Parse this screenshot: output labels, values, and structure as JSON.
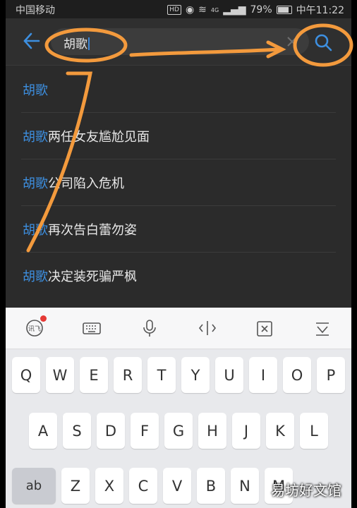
{
  "status": {
    "carrier": "中国移动",
    "battery": "79%",
    "time": "中午11:22",
    "hd": "HD",
    "net": "4G"
  },
  "search": {
    "query": "胡歌"
  },
  "suggestions": [
    {
      "hl": "胡歌",
      "rest": ""
    },
    {
      "hl": "胡歌",
      "rest": "两任女友尴尬见面"
    },
    {
      "hl": "胡歌",
      "rest": "公司陷入危机"
    },
    {
      "hl": "胡歌",
      "rest": "再次告白蕾勿姿"
    },
    {
      "hl": "胡歌",
      "rest": "决定装死骗严枫"
    }
  ],
  "keyboard": {
    "row1": [
      "Q",
      "W",
      "E",
      "R",
      "T",
      "Y",
      "U",
      "I",
      "O",
      "P"
    ],
    "row2": [
      "A",
      "S",
      "D",
      "F",
      "G",
      "H",
      "J",
      "K",
      "L"
    ],
    "row3_left": "ab",
    "row3": [
      "Z",
      "X",
      "C",
      "V",
      "B",
      "N",
      "M"
    ]
  },
  "watermark": "易坊好文馆",
  "colors": {
    "accent": "#3d8fe0",
    "annotation": "#f39a3d"
  }
}
